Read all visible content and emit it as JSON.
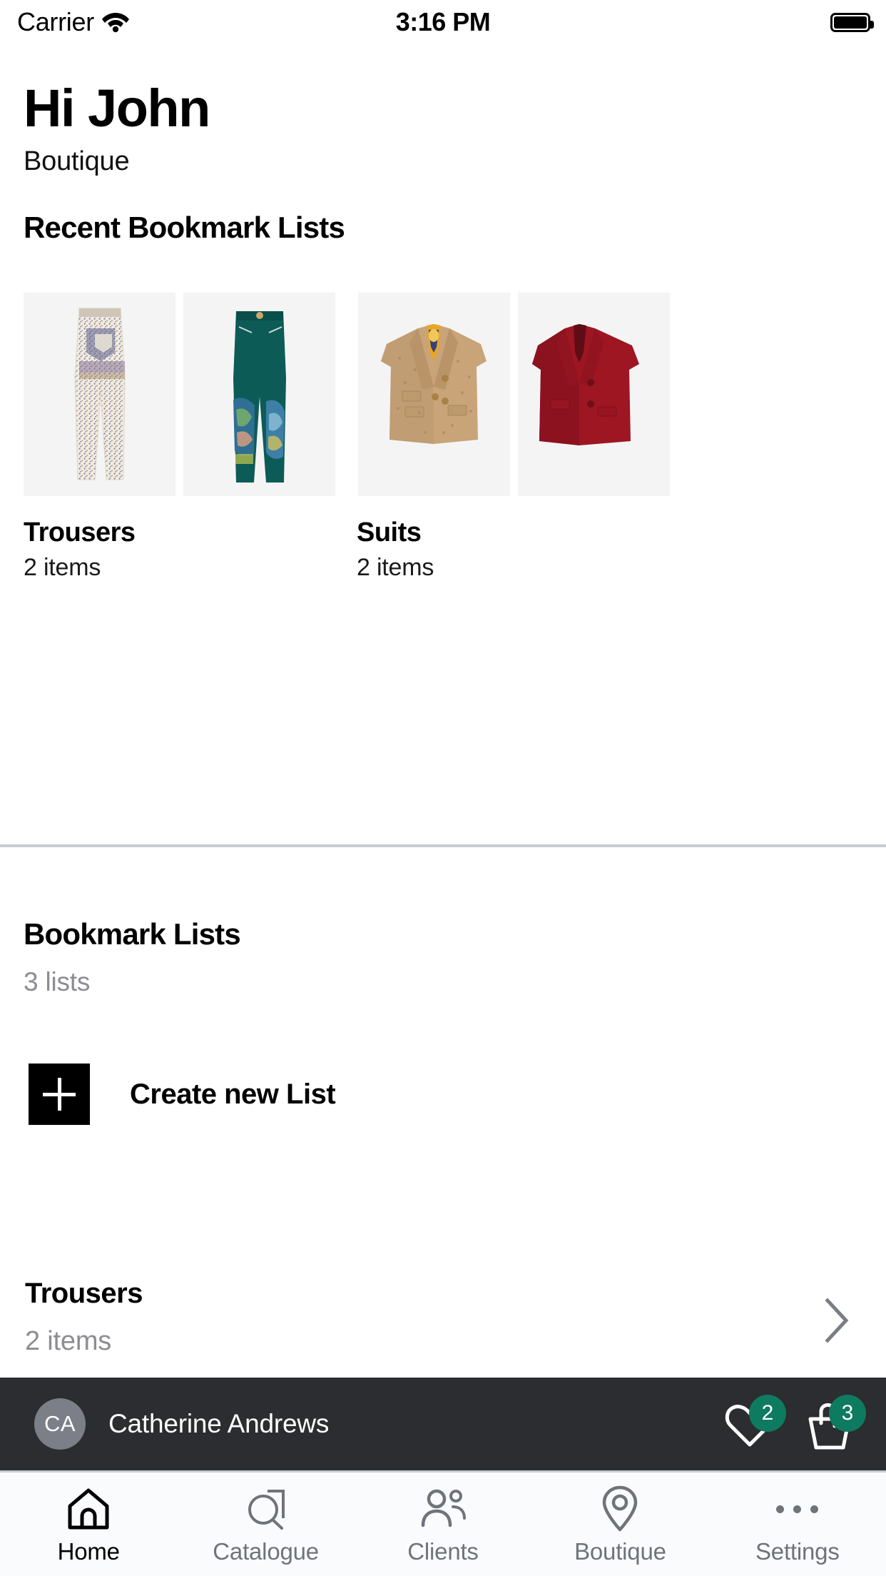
{
  "status_bar": {
    "carrier": "Carrier",
    "wifi_icon": "wifi-icon",
    "time": "3:16 PM",
    "battery_icon": "battery-full-icon"
  },
  "header": {
    "greeting": "Hi John",
    "shop_name": "Boutique"
  },
  "recent_section": {
    "title": "Recent Bookmark Lists",
    "cards": [
      {
        "title": "Trousers",
        "subtitle": "2 items",
        "thumbnails": [
          "paisley-print-wide-leg-trousers",
          "teal-printed-trousers"
        ]
      },
      {
        "title": "Suits",
        "subtitle": "2 items",
        "thumbnails": [
          "tan-double-breasted-blazer",
          "red-suit-jacket"
        ]
      }
    ]
  },
  "bookmark_section": {
    "title": "Bookmark Lists",
    "subtitle": "3 lists",
    "create_new": {
      "label": "Create new List",
      "icon": "plus-icon"
    },
    "lists": [
      {
        "title": "Trousers",
        "subtitle": "2 items",
        "chevron_icon": "chevron-right-icon"
      }
    ]
  },
  "client_bar": {
    "avatar_initials": "CA",
    "client_name": "Catherine Andrews",
    "actions": [
      {
        "icon": "heart-icon",
        "badge": "2",
        "badge_color": "#0e7a5f"
      },
      {
        "icon": "basket-icon",
        "badge": "3",
        "badge_color": "#0e7a5f"
      }
    ]
  },
  "tab_bar": {
    "active_index": 0,
    "tabs": [
      {
        "label": "Home",
        "icon": "home-icon"
      },
      {
        "label": "Catalogue",
        "icon": "catalogue-search-icon"
      },
      {
        "label": "Clients",
        "icon": "people-icon"
      },
      {
        "label": "Boutique",
        "icon": "map-pin-icon"
      },
      {
        "label": "Settings",
        "icon": "ellipsis-icon"
      }
    ]
  }
}
